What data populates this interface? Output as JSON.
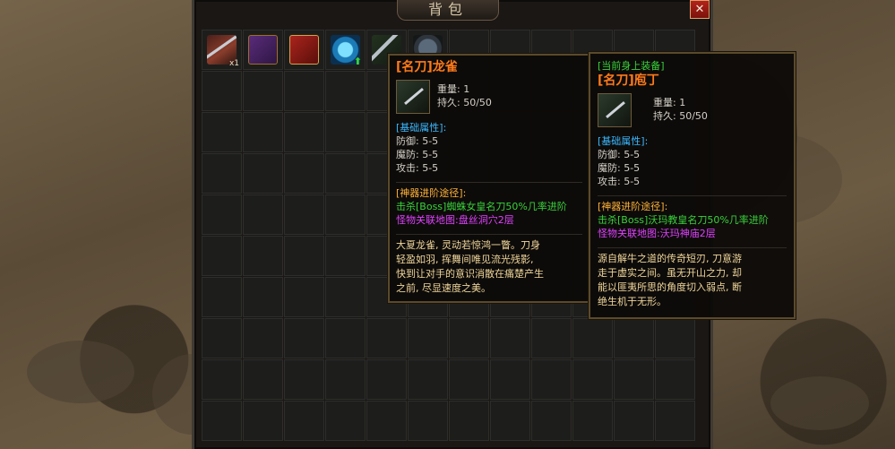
{
  "panel": {
    "title": "背包",
    "close_label": "✕"
  },
  "inventory": {
    "columns": 12,
    "rows": 10,
    "items": [
      {
        "slot": 0,
        "icon": "curved-sword-icon",
        "qty": "x1"
      },
      {
        "slot": 1,
        "icon": "purple-book-icon"
      },
      {
        "slot": 2,
        "icon": "red-book-icon"
      },
      {
        "slot": 3,
        "icon": "blue-gem-icon",
        "badge": "upgrade-arrow"
      },
      {
        "slot": 4,
        "icon": "blade-icon"
      },
      {
        "slot": 5,
        "icon": "helmet-icon"
      }
    ]
  },
  "tooltip_item": {
    "name": "[名刀]龙雀",
    "weight": "重量: 1",
    "durability": "持久: 50/50",
    "base_title": "[基础属性]:",
    "defense": "防御: 5-5",
    "magic_defense": "魔防: 5-5",
    "attack": "攻击: 5-5",
    "upgrade_title": "[神器进阶途径]:",
    "upgrade_line1": "击杀[Boss]蜘蛛女皇名刀50%几率进阶",
    "upgrade_line2": "怪物关联地图:盘丝洞穴2层",
    "desc_lines": [
      "大夏龙雀, 灵动若惊鸿一瞥。刀身",
      "轻盈如羽, 挥舞间唯见流光残影,",
      "快到让对手的意识消散在痛楚产生",
      "之前, 尽显速度之美。"
    ]
  },
  "tooltip_equipped": {
    "equipped_label": "[当前身上装备]",
    "name": "[名刀]庖丁",
    "weight": "重量: 1",
    "durability": "持久: 50/50",
    "base_title": "[基础属性]:",
    "defense": "防御: 5-5",
    "magic_defense": "魔防: 5-5",
    "attack": "攻击: 5-5",
    "upgrade_title": "[神器进阶途径]:",
    "upgrade_line1": "击杀[Boss]沃玛教皇名刀50%几率进阶",
    "upgrade_line2": "怪物关联地图:沃玛神庙2层",
    "desc_lines": [
      "源自解牛之道的传奇短刃, 刀意游",
      "走于虚实之间。虽无开山之力, 却",
      "能以匪夷所思的角度切入弱点, 断",
      "绝生机于无形。"
    ]
  },
  "colors": {
    "item_name": "#ff7a1a",
    "section_blue": "#3bb8ff",
    "section_orange": "#ffb23a",
    "green_text": "#39d23b",
    "magenta_text": "#e040ff",
    "desc_text": "#f0d69b"
  }
}
